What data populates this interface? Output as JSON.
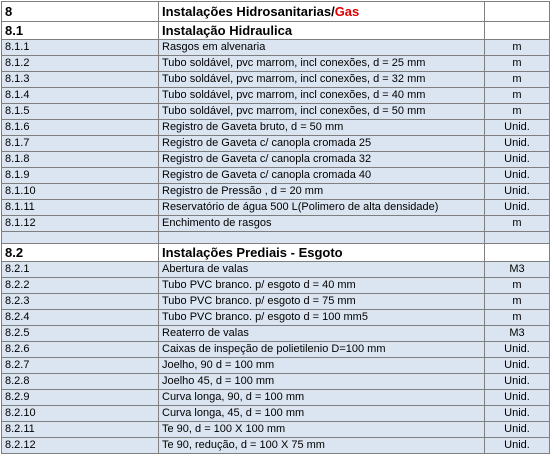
{
  "section": {
    "code": "8",
    "title_main": "Instalações Hidrosanitarias/",
    "title_accent": "Gas",
    "accent_color": "#e00000"
  },
  "groups": [
    {
      "code": "8.1",
      "title": "Instalação Hidraulica",
      "items": [
        {
          "code": "8.1.1",
          "desc": "Rasgos em alvenaria",
          "unit": "m"
        },
        {
          "code": "8.1.2",
          "desc": "Tubo soldável, pvc marrom, incl conexões, d = 25 mm",
          "unit": "m"
        },
        {
          "code": "8.1.3",
          "desc": "Tubo soldável, pvc marrom, incl conexões, d = 32 mm",
          "unit": "m"
        },
        {
          "code": "8.1.4",
          "desc": "Tubo soldável, pvc marrom, incl conexões, d = 40 mm",
          "unit": "m"
        },
        {
          "code": "8.1.5",
          "desc": "Tubo soldável, pvc marrom, incl conexões, d = 50 mm",
          "unit": "m"
        },
        {
          "code": "8.1.6",
          "desc": "Registro de Gaveta bruto, d = 50 mm",
          "unit": "Unid."
        },
        {
          "code": "8.1.7",
          "desc": "Registro de Gaveta c/ canopla cromada 25",
          "unit": "Unid."
        },
        {
          "code": "8.1.8",
          "desc": "Registro de Gaveta c/ canopla cromada 32",
          "unit": "Unid."
        },
        {
          "code": "8.1.9",
          "desc": "Registro de Gaveta c/ canopla cromada 40",
          "unit": "Unid."
        },
        {
          "code": "8.1.10",
          "desc": "Registro de Pressão , d = 20 mm",
          "unit": "Unid."
        },
        {
          "code": "8.1.11",
          "desc": "Reservatório de água 500 L(Polimero de alta densidade)",
          "unit": "Unid."
        },
        {
          "code": "8.1.12",
          "desc": "Enchimento de rasgos",
          "unit": "m"
        }
      ]
    },
    {
      "code": "8.2",
      "title": "Instalações Prediais - Esgoto",
      "items": [
        {
          "code": "8.2.1",
          "desc": "Abertura de valas",
          "unit": "M3"
        },
        {
          "code": "8.2.2",
          "desc": "Tubo PVC branco. p/ esgoto d = 40 mm",
          "unit": "m"
        },
        {
          "code": "8.2.3",
          "desc": "Tubo PVC branco. p/ esgoto d = 75 mm",
          "unit": "m"
        },
        {
          "code": "8.2.4",
          "desc": "Tubo PVC branco. p/ esgoto d = 100 mm5",
          "unit": "m"
        },
        {
          "code": "8.2.5",
          "desc": "Reaterro de valas",
          "unit": "M3"
        },
        {
          "code": "8.2.6",
          "desc": "Caixas de inspeção de polietilenio D=100 mm",
          "unit": "Unid."
        },
        {
          "code": "8.2.7",
          "desc": "Joelho, 90 d = 100 mm",
          "unit": "Unid."
        },
        {
          "code": "8.2.8",
          "desc": "Joelho 45, d = 100 mm",
          "unit": "Unid."
        },
        {
          "code": "8.2.9",
          "desc": "Curva longa, 90, d = 100 mm",
          "unit": "Unid."
        },
        {
          "code": "8.2.10",
          "desc": "Curva longa, 45, d = 100 mm",
          "unit": "Unid."
        },
        {
          "code": "8.2.11",
          "desc": "Te 90, d = 100 X 100 mm",
          "unit": "Unid."
        },
        {
          "code": "8.2.12",
          "desc": "Te 90, redução, d = 100 X 75 mm",
          "unit": "Unid."
        }
      ]
    }
  ]
}
